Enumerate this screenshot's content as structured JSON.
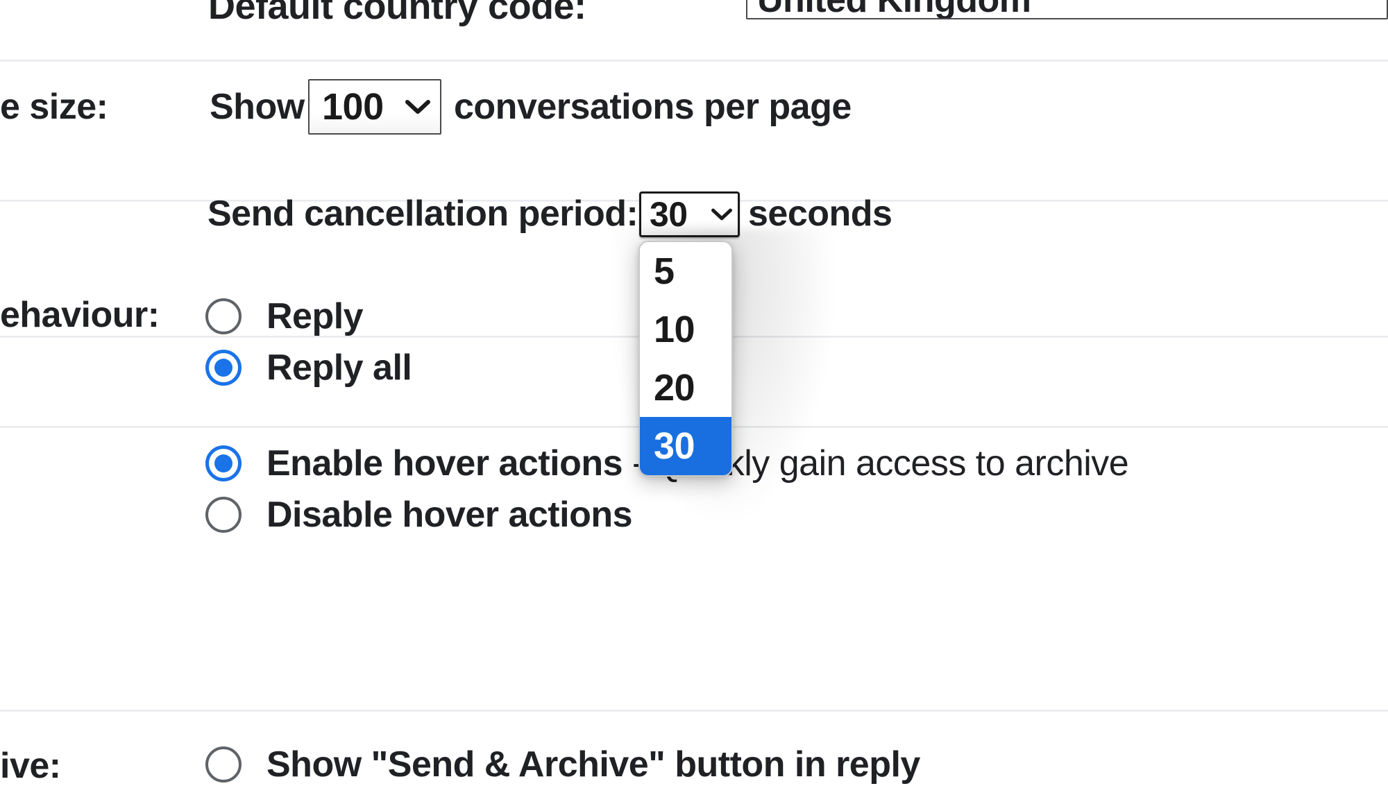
{
  "settings": {
    "country_code_row": {
      "label": "Default country code:",
      "input_value": "United Kingdom"
    },
    "page_size_row": {
      "label": "e size:",
      "prefix": "Show",
      "select_value": "100",
      "suffix": "conversations per page"
    },
    "send_cancellation_row": {
      "label": "Send cancellation period:",
      "select_value": "30",
      "suffix": "seconds",
      "options": [
        "5",
        "10",
        "20",
        "30"
      ],
      "selected_option": "30"
    },
    "reply_behaviour_row": {
      "label": "ehaviour:",
      "options": [
        {
          "label": "Reply",
          "checked": false
        },
        {
          "label": "Reply all",
          "checked": true
        }
      ]
    },
    "hover_actions_row": {
      "options": [
        {
          "label": "Enable hover actions",
          "description": "- Quickly gain access to archive",
          "checked": true
        },
        {
          "label": "Disable hover actions",
          "description": "",
          "checked": false
        }
      ]
    },
    "send_and_archive_row": {
      "label": "ive:",
      "options": [
        {
          "label": "Show \"Send & Archive\" button in reply",
          "checked": false
        }
      ]
    }
  },
  "icons": {
    "select_chevron": "chevron-down-icon"
  },
  "colors": {
    "accent": "#1a73e8",
    "dropdown_selected_bg": "#1a6fe0",
    "divider": "#e8eaed",
    "text": "#202124"
  }
}
